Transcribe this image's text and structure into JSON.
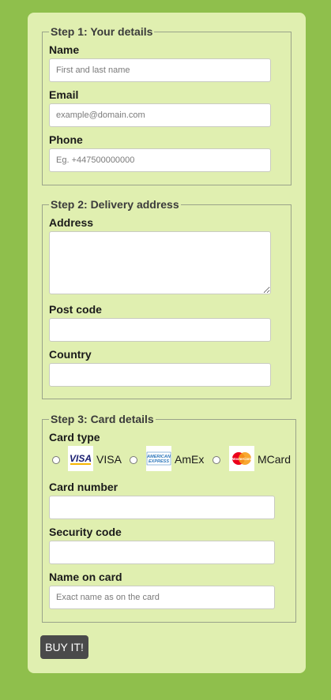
{
  "step1": {
    "legend": "Step 1: Your details",
    "name_label": "Name",
    "name_placeholder": "First and last name",
    "email_label": "Email",
    "email_placeholder": "example@domain.com",
    "phone_label": "Phone",
    "phone_placeholder": "Eg. +447500000000"
  },
  "step2": {
    "legend": "Step 2: Delivery address",
    "address_label": "Address",
    "postcode_label": "Post code",
    "country_label": "Country"
  },
  "step3": {
    "legend": "Step 3: Card details",
    "cardtype_label": "Card type",
    "card_types": [
      {
        "label": "VISA",
        "icon": "visa-logo-icon",
        "color": "#1a1f71"
      },
      {
        "label": "AmEx",
        "icon": "amex-logo-icon",
        "color": "#2e77bb"
      },
      {
        "label": "MCard",
        "icon": "mastercard-logo-icon",
        "color": "#eb001b"
      }
    ],
    "cardnumber_label": "Card number",
    "security_label": "Security code",
    "nameoncard_label": "Name on card",
    "nameoncard_placeholder": "Exact name as on the card"
  },
  "buy_button": "BUY IT!",
  "colors": {
    "page_bg": "#8fbf4c",
    "card_bg": "#e0efb0",
    "button_bg": "#4a4a4a"
  }
}
